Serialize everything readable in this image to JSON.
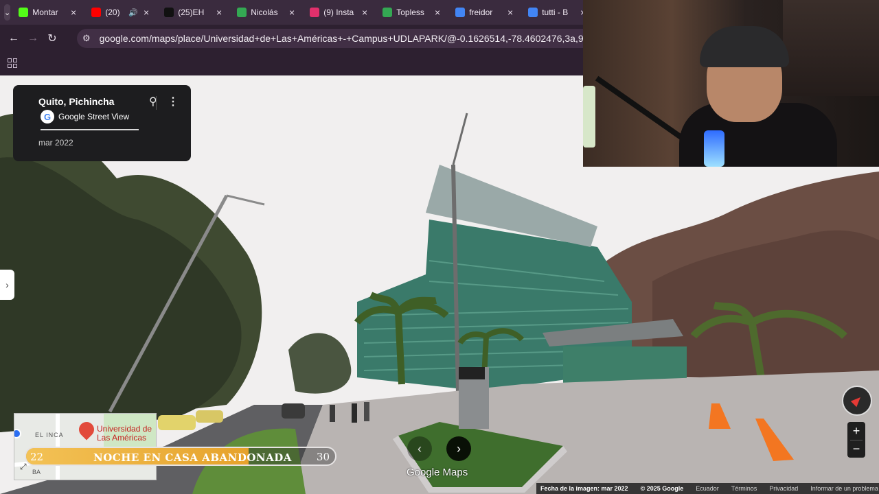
{
  "tabs": [
    {
      "title": "Montar",
      "icon": "kick-icon",
      "color": "#53fc18"
    },
    {
      "title": "(20)",
      "icon": "youtube-icon",
      "color": "#ff0000",
      "audio": true
    },
    {
      "title": "(25)EH",
      "icon": "tiktok-icon",
      "color": "#111111"
    },
    {
      "title": "Nicolás",
      "icon": "maps-pin-icon",
      "color": "#34a853"
    },
    {
      "title": "(9) Insta",
      "icon": "instagram-icon",
      "color": "#e1306c"
    },
    {
      "title": "Topless",
      "icon": "maps-pin-icon",
      "color": "#34a853"
    },
    {
      "title": "freidor",
      "icon": "google-icon",
      "color": "#4285f4"
    },
    {
      "title": "tutti - B",
      "icon": "google-icon",
      "color": "#4285f4"
    }
  ],
  "address_bar": {
    "url": "google.com/maps/place/Universidad+de+Las+Américas+-+Campus+UDLAPARK/@-0.1626514,-78.4602476,3a,90y,123.8"
  },
  "street_view": {
    "location": "Quito, Pichincha",
    "source": "Google Street View",
    "date": "mar 2022",
    "brand": "Google Maps"
  },
  "minimap": {
    "place_line1": "Universidad de",
    "place_line2": "Las Américas",
    "area_label": "EL INCA",
    "edge_label": "BA"
  },
  "progress_overlay": {
    "start": "22",
    "label": "NOCHE EN CASA ABANDONADA",
    "end": "30",
    "fraction": 0.72
  },
  "footer": {
    "image_date": "Fecha de la imagen: mar 2022",
    "copyright": "© 2025 Google",
    "country": "Ecuador",
    "terms": "Términos",
    "privacy": "Privacidad",
    "report": "Informar de un problema"
  },
  "colors": {
    "browser_frame": "#3a2b3e",
    "progress_fill": "#f3c256"
  }
}
